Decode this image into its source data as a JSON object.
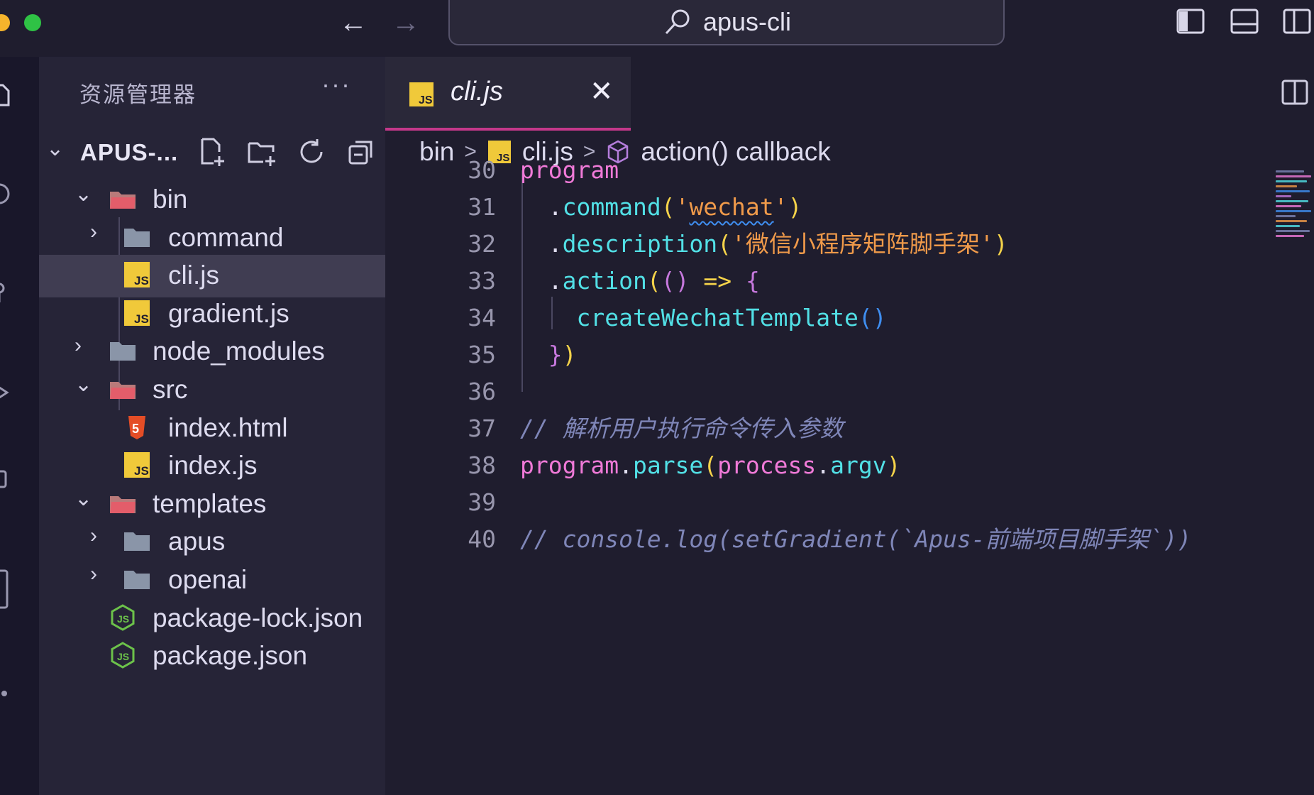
{
  "titlebar": {
    "search_text": "apus-cli"
  },
  "sidebar": {
    "title": "资源管理器",
    "more": "···",
    "root_label": "APUS-...",
    "tree": [
      {
        "label": "bin",
        "kind": "folder-open",
        "depth": 0,
        "expanded": true
      },
      {
        "label": "command",
        "kind": "folder",
        "depth": 1,
        "expanded": false
      },
      {
        "label": "cli.js",
        "kind": "js",
        "depth": 1,
        "selected": true
      },
      {
        "label": "gradient.js",
        "kind": "js",
        "depth": 1
      },
      {
        "label": "node_modules",
        "kind": "folder",
        "depth": 0,
        "expanded": false
      },
      {
        "label": "src",
        "kind": "folder-open",
        "depth": 0,
        "expanded": true
      },
      {
        "label": "index.html",
        "kind": "html",
        "depth": 1
      },
      {
        "label": "index.js",
        "kind": "js",
        "depth": 1
      },
      {
        "label": "templates",
        "kind": "folder-open",
        "depth": 0,
        "expanded": true
      },
      {
        "label": "apus",
        "kind": "folder",
        "depth": 1,
        "expanded": false
      },
      {
        "label": "openai",
        "kind": "folder",
        "depth": 1,
        "expanded": false
      },
      {
        "label": "package-lock.json",
        "kind": "node",
        "depth": 0
      },
      {
        "label": "package.json",
        "kind": "node",
        "depth": 0
      }
    ]
  },
  "editor": {
    "tab_label": "cli.js",
    "tab_close": "✕",
    "breadcrumb": [
      "bin",
      "cli.js",
      "action() callback"
    ],
    "breadcrumb_sep": ">",
    "lines": [
      {
        "n": "30",
        "tokens": [
          {
            "t": "program",
            "c": "#f07ad8"
          }
        ]
      },
      {
        "n": "31",
        "tokens": [
          {
            "t": "  .",
            "c": "#e0def0"
          },
          {
            "t": "command",
            "c": "#52e0e6"
          },
          {
            "t": "(",
            "c": "#f5d34a"
          },
          {
            "t": "'",
            "c": "#f09a4a"
          },
          {
            "t": "wechat",
            "c": "#f09a4a",
            "sq": true
          },
          {
            "t": "'",
            "c": "#f09a4a"
          },
          {
            "t": ")",
            "c": "#f5d34a"
          }
        ]
      },
      {
        "n": "32",
        "tokens": [
          {
            "t": "  .",
            "c": "#e0def0"
          },
          {
            "t": "description",
            "c": "#52e0e6"
          },
          {
            "t": "(",
            "c": "#f5d34a"
          },
          {
            "t": "'微信小程序矩阵脚手架'",
            "c": "#f09a4a"
          },
          {
            "t": ")",
            "c": "#f5d34a"
          }
        ]
      },
      {
        "n": "33",
        "tokens": [
          {
            "t": "  .",
            "c": "#e0def0"
          },
          {
            "t": "action",
            "c": "#52e0e6"
          },
          {
            "t": "(",
            "c": "#f5d34a"
          },
          {
            "t": "()",
            "c": "#c678dd"
          },
          {
            "t": " ",
            "c": "#e0def0"
          },
          {
            "t": "=>",
            "c": "#f5d34a"
          },
          {
            "t": " ",
            "c": "#e0def0"
          },
          {
            "t": "{",
            "c": "#c678dd"
          }
        ]
      },
      {
        "n": "34",
        "tokens": [
          {
            "t": "    createWechatTemplate",
            "c": "#52e0e6"
          },
          {
            "t": "()",
            "c": "#3f8ef0"
          }
        ]
      },
      {
        "n": "35",
        "tokens": [
          {
            "t": "  }",
            "c": "#c678dd"
          },
          {
            "t": ")",
            "c": "#f5d34a"
          }
        ]
      },
      {
        "n": "36",
        "tokens": []
      },
      {
        "n": "37",
        "tokens": [
          {
            "t": "// 解析用户执行命令传入参数",
            "c": "#7f86b8",
            "i": true
          }
        ]
      },
      {
        "n": "38",
        "tokens": [
          {
            "t": "program",
            "c": "#f07ad8"
          },
          {
            "t": ".",
            "c": "#e0def0"
          },
          {
            "t": "parse",
            "c": "#52e0e6"
          },
          {
            "t": "(",
            "c": "#f5d34a"
          },
          {
            "t": "process",
            "c": "#f07ad8"
          },
          {
            "t": ".",
            "c": "#e0def0"
          },
          {
            "t": "argv",
            "c": "#52e0e6"
          },
          {
            "t": ")",
            "c": "#f5d34a"
          }
        ]
      },
      {
        "n": "39",
        "tokens": []
      },
      {
        "n": "40",
        "tokens": [
          {
            "t": "// console.log(setGradient(`Apus-前端项目脚手架`))",
            "c": "#7f86b8",
            "i": true
          }
        ]
      }
    ]
  },
  "colors": {
    "accent_tab": "#c4388a",
    "js_icon": "#f0c93a",
    "html_icon": "#e44d26",
    "node_icon": "#6cc24a",
    "folder": "#8a95a8"
  }
}
